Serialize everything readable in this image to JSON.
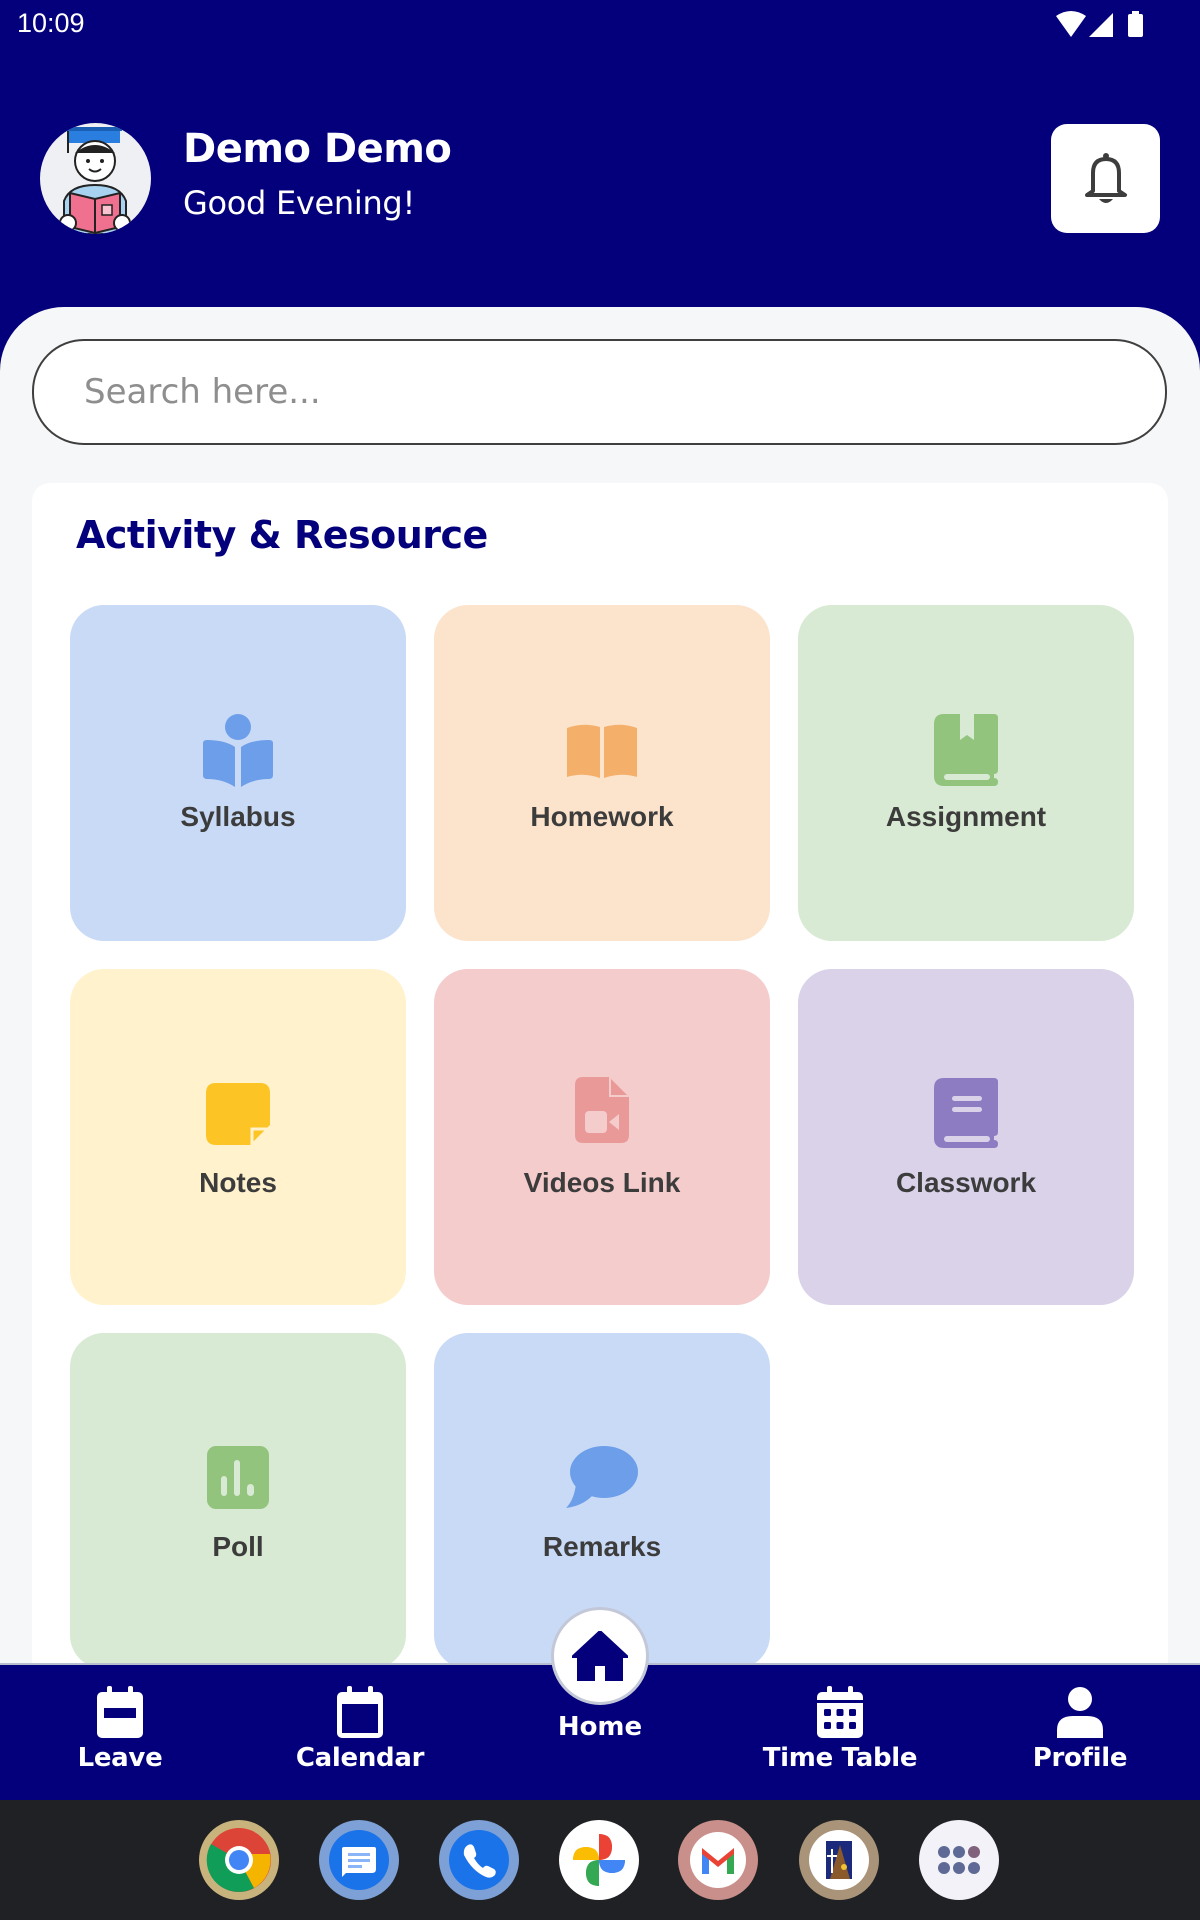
{
  "status_bar": {
    "time": "10:09",
    "icons": [
      "wifi-icon",
      "cellular-signal-icon",
      "battery-icon"
    ]
  },
  "header": {
    "user_name": "Demo Demo",
    "greeting": "Good Evening!",
    "avatar": "student-avatar",
    "notification_icon": "bell-icon"
  },
  "search": {
    "placeholder": "Search here...",
    "value": ""
  },
  "section": {
    "title": "Activity & Resource",
    "title_color": "#04007b"
  },
  "tiles": [
    {
      "label": "Syllabus",
      "icon": "reading-book-icon",
      "bg": "#c9daf6",
      "fg": "#6d9eea"
    },
    {
      "label": "Homework",
      "icon": "open-book-icon",
      "bg": "#fce4cc",
      "fg": "#f4b06b"
    },
    {
      "label": "Assignment",
      "icon": "bookmarked-book-icon",
      "bg": "#d8ead3",
      "fg": "#93c47d"
    },
    {
      "label": "Notes",
      "icon": "sticky-note-icon",
      "bg": "#fff2cc",
      "fg": "#fdc425"
    },
    {
      "label": "Videos Link",
      "icon": "video-file-icon",
      "bg": "#f4cccc",
      "fg": "#ea9999"
    },
    {
      "label": "Classwork",
      "icon": "notebook-icon",
      "bg": "#d9d2e9",
      "fg": "#8e7cc3"
    },
    {
      "label": "Poll",
      "icon": "poll-chart-icon",
      "bg": "#d8ead3",
      "fg": "#93c47d"
    },
    {
      "label": "Remarks",
      "icon": "chat-bubble-icon",
      "bg": "#c9daf6",
      "fg": "#6d9eea"
    }
  ],
  "bottom_nav": {
    "items": [
      {
        "label": "Leave",
        "icon": "calendar-minus-icon"
      },
      {
        "label": "Calendar",
        "icon": "calendar-icon"
      },
      {
        "label": "Home",
        "icon": "home-icon",
        "active": true
      },
      {
        "label": "Time Table",
        "icon": "calendar-grid-icon"
      },
      {
        "label": "Profile",
        "icon": "person-icon"
      }
    ],
    "bg": "#04007b"
  },
  "dock": {
    "apps": [
      {
        "name": "Chrome"
      },
      {
        "name": "Messages"
      },
      {
        "name": "Phone"
      },
      {
        "name": "Photos"
      },
      {
        "name": "Gmail"
      },
      {
        "name": "School App"
      },
      {
        "name": "App Drawer"
      }
    ]
  }
}
